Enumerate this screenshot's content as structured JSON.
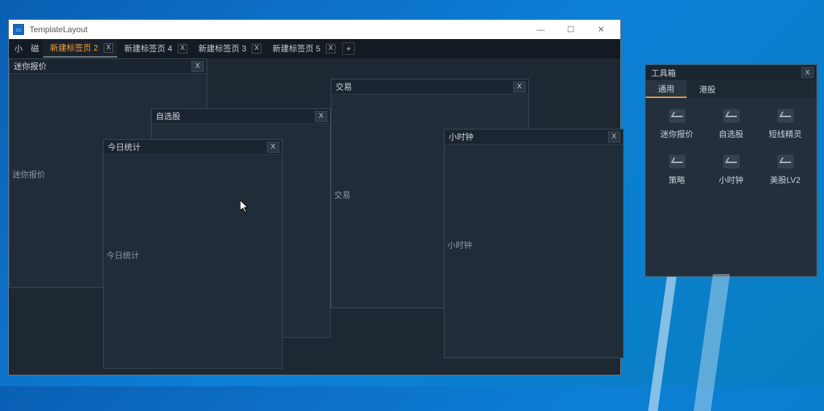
{
  "window": {
    "title": "TemplateLayout",
    "controls": {
      "minimize": "—",
      "maximize": "☐",
      "close": "✕"
    }
  },
  "tabstrip": {
    "mini1": "小",
    "mini2": "磁",
    "tabs": [
      {
        "label": "新建标签页 2",
        "active": true
      },
      {
        "label": "新建标签页 4",
        "active": false
      },
      {
        "label": "新建标签页 3",
        "active": false
      },
      {
        "label": "新建标签页 5",
        "active": false
      }
    ],
    "close_x": "X",
    "add": "+"
  },
  "panels": {
    "mini_quote": {
      "title": "迷你报价",
      "body": "迷你报价",
      "close": "X"
    },
    "watchlist": {
      "title": "自选股",
      "body": "",
      "close": "X"
    },
    "today_stats": {
      "title": "今日统计",
      "body": "今日统计",
      "close": "X"
    },
    "trade": {
      "title": "交易",
      "body": "交易",
      "close": "X"
    },
    "small_clock": {
      "title": "小时钟",
      "body": "小时钟",
      "close": "X"
    }
  },
  "toolbox": {
    "title": "工具箱",
    "close": "X",
    "tabs": [
      {
        "label": "通用",
        "active": true
      },
      {
        "label": "港股",
        "active": false
      }
    ],
    "items": [
      {
        "label": "迷你报价"
      },
      {
        "label": "自选股"
      },
      {
        "label": "短线精灵"
      },
      {
        "label": "策略"
      },
      {
        "label": "小时钟"
      },
      {
        "label": "美股LV2"
      }
    ]
  }
}
